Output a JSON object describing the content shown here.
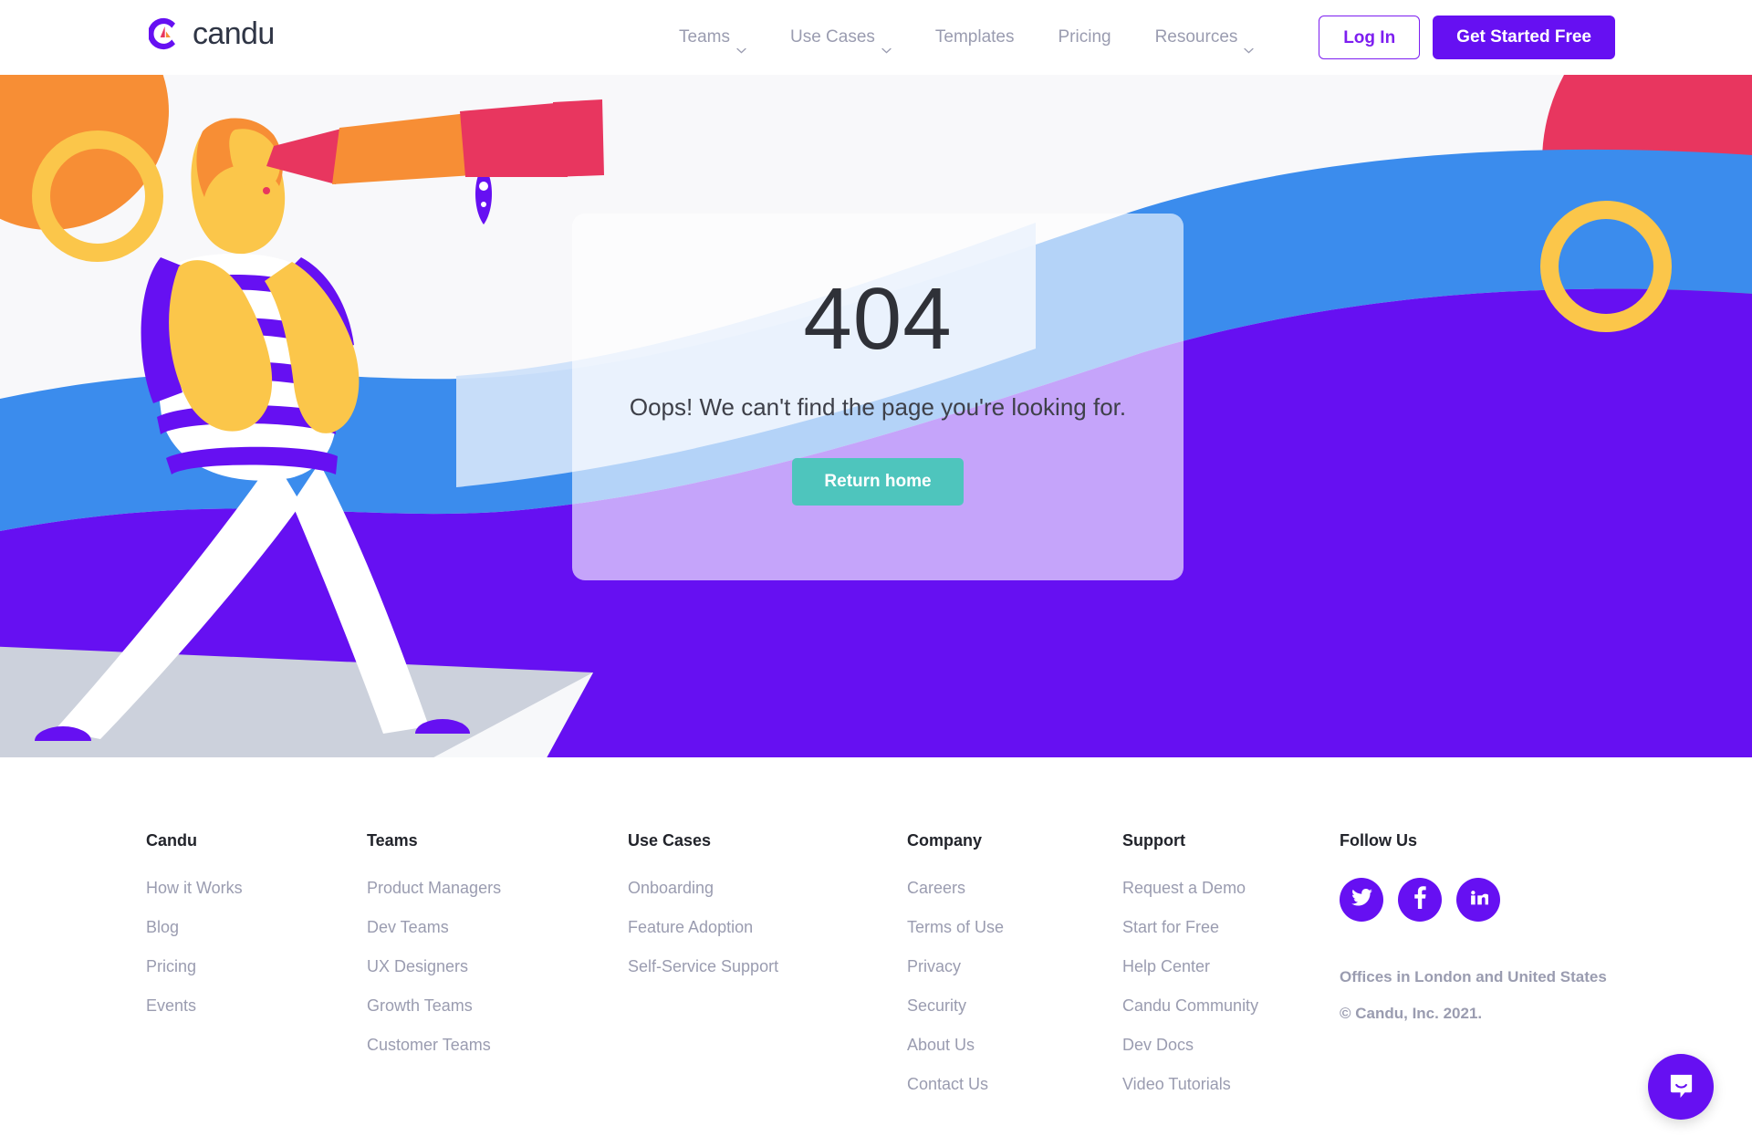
{
  "brand": {
    "name": "candu",
    "logo_icon": "candu-logo-mark"
  },
  "nav": {
    "items": [
      {
        "label": "Teams",
        "has_dropdown": true,
        "icon": "chevron-down-icon"
      },
      {
        "label": "Use Cases",
        "has_dropdown": true,
        "icon": "chevron-down-icon"
      },
      {
        "label": "Templates",
        "has_dropdown": false
      },
      {
        "label": "Pricing",
        "has_dropdown": false
      },
      {
        "label": "Resources",
        "has_dropdown": true,
        "icon": "chevron-down-icon"
      }
    ],
    "login_label": "Log In",
    "cta_label": "Get Started Free"
  },
  "hero": {
    "error_code": "404",
    "message": "Oops! We can't find the page you're looking for.",
    "button_label": "Return home",
    "illustration": "explorer-with-telescope",
    "colors": {
      "purple": "#6610f2",
      "blue": "#3b8ced",
      "light_blue": "#cfe2fa",
      "lavender": "#d9c9f5",
      "yellow": "#fbc64a",
      "orange": "#f78e35",
      "pink": "#e8365f",
      "grey_platform": "#ccd1dc",
      "background": "#f8f8fa"
    }
  },
  "footer": {
    "columns": [
      {
        "title": "Candu",
        "links": [
          "How it Works",
          "Blog",
          "Pricing",
          "Events"
        ]
      },
      {
        "title": "Teams",
        "links": [
          "Product Managers",
          "Dev Teams",
          "UX Designers",
          "Growth Teams",
          "Customer Teams"
        ]
      },
      {
        "title": "Use Cases",
        "links": [
          "Onboarding",
          "Feature Adoption",
          "Self-Service Support"
        ]
      },
      {
        "title": "Company",
        "links": [
          "Careers",
          "Terms of Use",
          "Privacy",
          "Security",
          "About Us",
          "Contact Us"
        ]
      },
      {
        "title": "Support",
        "links": [
          "Request a Demo",
          "Start for Free",
          "Help Center",
          "Candu Community",
          "Dev Docs",
          "Video Tutorials"
        ]
      }
    ],
    "follow": {
      "title": "Follow Us",
      "socials": [
        {
          "name": "twitter-icon",
          "label": "Twitter"
        },
        {
          "name": "facebook-icon",
          "label": "Facebook"
        },
        {
          "name": "linkedin-icon",
          "label": "LinkedIn"
        }
      ],
      "offices": "Offices in London and United States",
      "copyright": "© Candu, Inc. 2021."
    }
  },
  "chat": {
    "icon": "intercom-chat-icon",
    "label": "Open chat"
  }
}
